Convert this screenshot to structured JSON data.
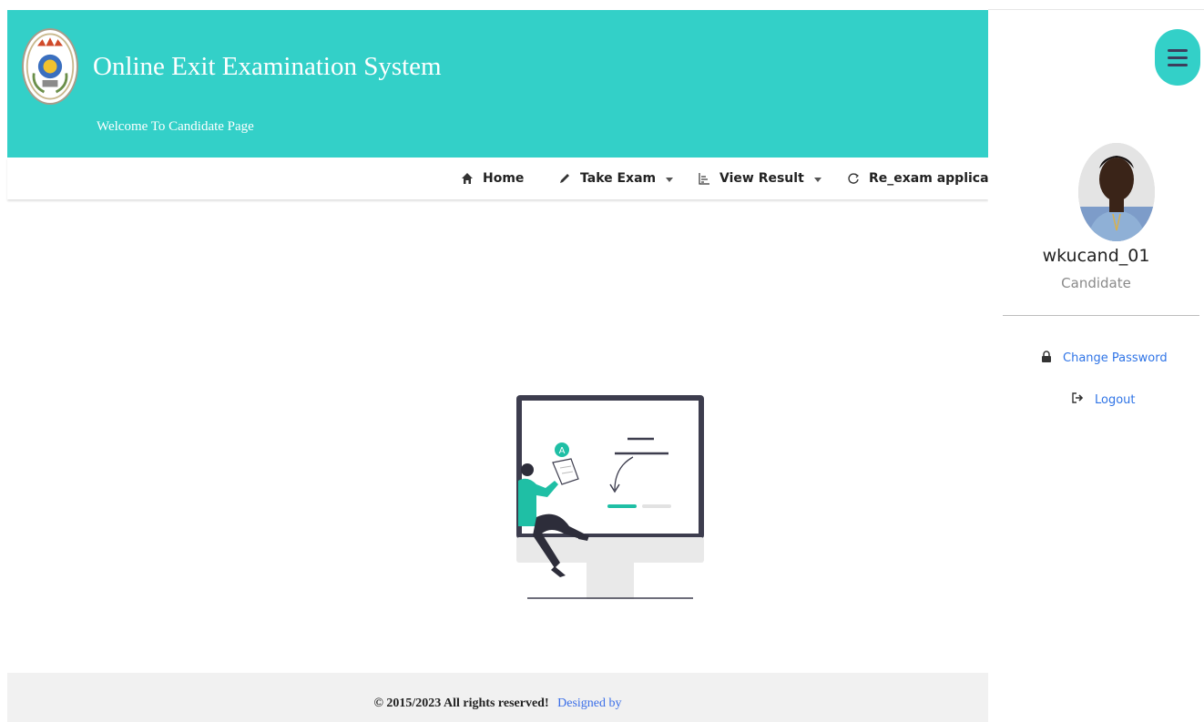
{
  "header": {
    "title": "Online Exit Examination System",
    "subtitle": "Welcome To Candidate Page",
    "logo_icon": "university-seal-icon",
    "bg_color": "#33d0c8"
  },
  "nav": {
    "items": [
      {
        "label": "Home",
        "icon": "home-icon",
        "dropdown": false
      },
      {
        "label": "Take Exam",
        "icon": "pencil-icon",
        "dropdown": true
      },
      {
        "label": "View Result",
        "icon": "chart-icon",
        "dropdown": true
      },
      {
        "label": "Re_exam applicant",
        "icon": "refresh-icon",
        "dropdown": false
      }
    ]
  },
  "footer": {
    "copyright": "© 2015/2023 All rights reserved!",
    "designed_by": "Designed by"
  },
  "sidebar": {
    "menu_icon": "hamburger-icon",
    "username": "wkucand_01",
    "role": "Candidate",
    "links": [
      {
        "label": "Change Password",
        "icon": "lock-icon"
      },
      {
        "label": "Logout",
        "icon": "logout-icon"
      }
    ]
  },
  "illustration": {
    "badge_letter": "A"
  }
}
